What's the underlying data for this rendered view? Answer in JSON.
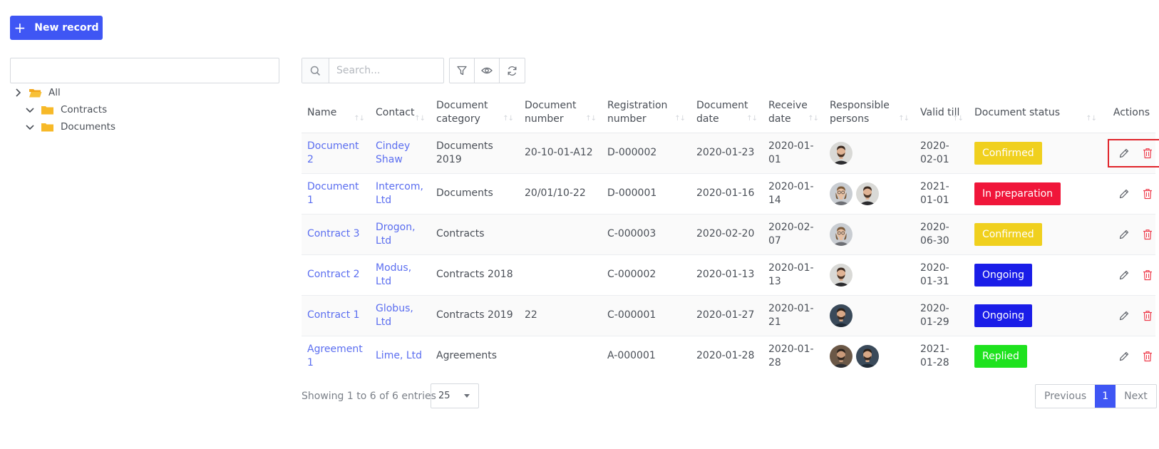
{
  "header": {
    "new_record_label": "New record"
  },
  "tree": {
    "search_value": "",
    "items": [
      {
        "label": "All",
        "expanded": false,
        "level": 0
      },
      {
        "label": "Contracts",
        "expanded": true,
        "level": 1
      },
      {
        "label": "Documents",
        "expanded": true,
        "level": 1
      }
    ]
  },
  "toolbar": {
    "search_placeholder": "Search..."
  },
  "table": {
    "columns": [
      "Name",
      "Contact",
      "Document category",
      "Document number",
      "Registration number",
      "Document date",
      "Receive date",
      "Responsible persons",
      "Valid till",
      "Document status",
      "Actions"
    ],
    "rows": [
      {
        "name": "Document 2",
        "contact": "Cindey Shaw",
        "category": "Documents 2019",
        "doc_number": "20-10-01-A12",
        "reg_number": "D-000002",
        "doc_date": "2020-01-23",
        "receive_date": "2020-01-01",
        "persons": [
          "man-beard"
        ],
        "valid_till": "2020-02-01",
        "status": "Confirmed",
        "status_color": "#f0d01e"
      },
      {
        "name": "Document 1",
        "contact": "Intercom, Ltd",
        "category": "Documents",
        "doc_number": "20/01/10-22",
        "reg_number": "D-000001",
        "doc_date": "2020-01-16",
        "receive_date": "2020-01-14",
        "persons": [
          "woman-glasses",
          "man-beard"
        ],
        "valid_till": "2021-01-01",
        "status": "In preparation",
        "status_color": "#f0163a"
      },
      {
        "name": "Contract 3",
        "contact": "Drogon, Ltd",
        "category": "Contracts",
        "doc_number": "",
        "reg_number": "C-000003",
        "doc_date": "2020-02-20",
        "receive_date": "2020-02-07",
        "persons": [
          "woman-glasses"
        ],
        "valid_till": "2020-06-30",
        "status": "Confirmed",
        "status_color": "#f0d01e"
      },
      {
        "name": "Contract 2",
        "contact": "Modus, Ltd",
        "category": "Contracts 2018",
        "doc_number": "",
        "reg_number": "C-000002",
        "doc_date": "2020-01-13",
        "receive_date": "2020-01-13",
        "persons": [
          "man-beard"
        ],
        "valid_till": "2020-01-31",
        "status": "Ongoing",
        "status_color": "#1a1de8"
      },
      {
        "name": "Contract 1",
        "contact": "Globus, Ltd",
        "category": "Contracts 2019",
        "doc_number": "22",
        "reg_number": "C-000001",
        "doc_date": "2020-01-27",
        "receive_date": "2020-01-21",
        "persons": [
          "man-dark-bg"
        ],
        "valid_till": "2020-01-29",
        "status": "Ongoing",
        "status_color": "#1a1de8"
      },
      {
        "name": "Agreement 1",
        "contact": "Lime, Ltd",
        "category": "Agreements",
        "doc_number": "",
        "reg_number": "A-000001",
        "doc_date": "2020-01-28",
        "receive_date": "2020-01-28",
        "persons": [
          "man-brown",
          "man-dark-bg"
        ],
        "valid_till": "2021-01-28",
        "status": "Replied",
        "status_color": "#1ee21e"
      }
    ]
  },
  "footer": {
    "showing": "Showing 1 to 6 of 6 entries",
    "page_size": "25",
    "prev_label": "Previous",
    "current_page": "1",
    "next_label": "Next"
  },
  "colors": {
    "primary": "#3f56f4",
    "link": "#5b6ef0",
    "delete": "#ee3b4b",
    "highlight": "#e0242a"
  }
}
